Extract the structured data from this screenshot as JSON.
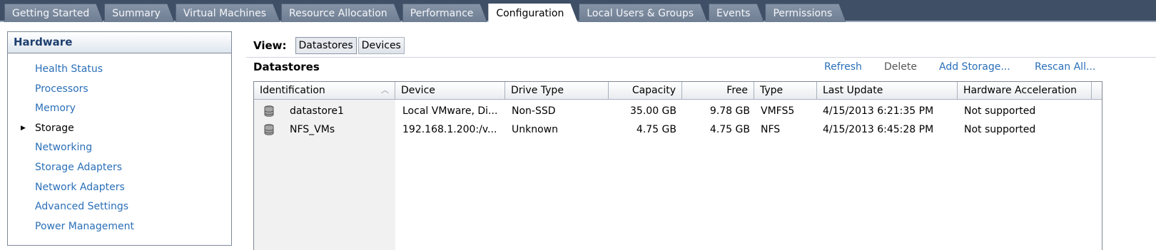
{
  "tabs": [
    {
      "label": "Getting Started"
    },
    {
      "label": "Summary"
    },
    {
      "label": "Virtual Machines"
    },
    {
      "label": "Resource Allocation"
    },
    {
      "label": "Performance"
    },
    {
      "label": "Configuration"
    },
    {
      "label": "Local Users & Groups"
    },
    {
      "label": "Events"
    },
    {
      "label": "Permissions"
    }
  ],
  "hardware": {
    "title": "Hardware",
    "items": [
      {
        "label": "Health Status"
      },
      {
        "label": "Processors"
      },
      {
        "label": "Memory"
      },
      {
        "label": "Storage"
      },
      {
        "label": "Networking"
      },
      {
        "label": "Storage Adapters"
      },
      {
        "label": "Network Adapters"
      },
      {
        "label": "Advanced Settings"
      },
      {
        "label": "Power Management"
      }
    ]
  },
  "view": {
    "label": "View:",
    "options": [
      "Datastores",
      "Devices"
    ],
    "selected": "Datastores"
  },
  "datastores": {
    "title": "Datastores",
    "actions": {
      "refresh": "Refresh",
      "delete": "Delete",
      "add_storage": "Add Storage...",
      "rescan_all": "Rescan All..."
    },
    "columns": [
      "Identification",
      "Device",
      "Drive Type",
      "Capacity",
      "Free",
      "Type",
      "Last Update",
      "Hardware Acceleration"
    ],
    "rows": [
      [
        "datastore1",
        "Local VMware, Di...",
        "Non-SSD",
        "35.00 GB",
        "9.78 GB",
        "VMFS5",
        "4/15/2013 6:21:35 PM",
        "Not supported"
      ],
      [
        "NFS_VMs",
        "192.168.1.200:/v...",
        "Unknown",
        "4.75 GB",
        "4.75 GB",
        "NFS",
        "4/15/2013 6:45:28 PM",
        "Not supported"
      ]
    ]
  },
  "colors": {
    "tabbar": "#3e4f66",
    "link": "#2a6fb8",
    "panel_title": "#1d3f6e"
  },
  "icons": {
    "row_icon": "database-icon",
    "selected_marker": "triangle-right-icon",
    "sort_marker": "sort-ascending-icon"
  }
}
